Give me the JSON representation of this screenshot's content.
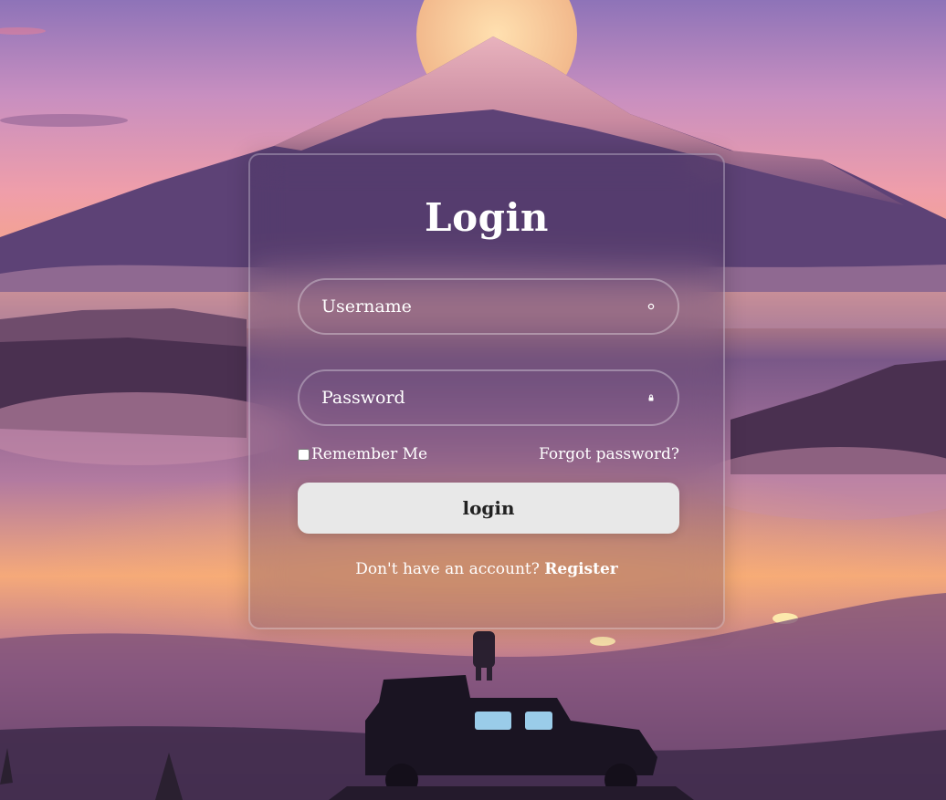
{
  "login": {
    "title": "Login",
    "username": {
      "placeholder": "Username",
      "icon": "user-icon"
    },
    "password": {
      "placeholder": "Password",
      "icon": "lock-icon"
    },
    "remember_label": "Remember Me",
    "forgot_label": "Forgot password?",
    "submit_label": "login",
    "register_prompt": "Don't have an account?",
    "register_link": "Register"
  },
  "colors": {
    "sky_top": "#8e6fb0",
    "sky_sunset": "#f0a070",
    "mountain": "#c98a9e",
    "button_bg": "#e8e8e8",
    "text": "#ffffff"
  }
}
